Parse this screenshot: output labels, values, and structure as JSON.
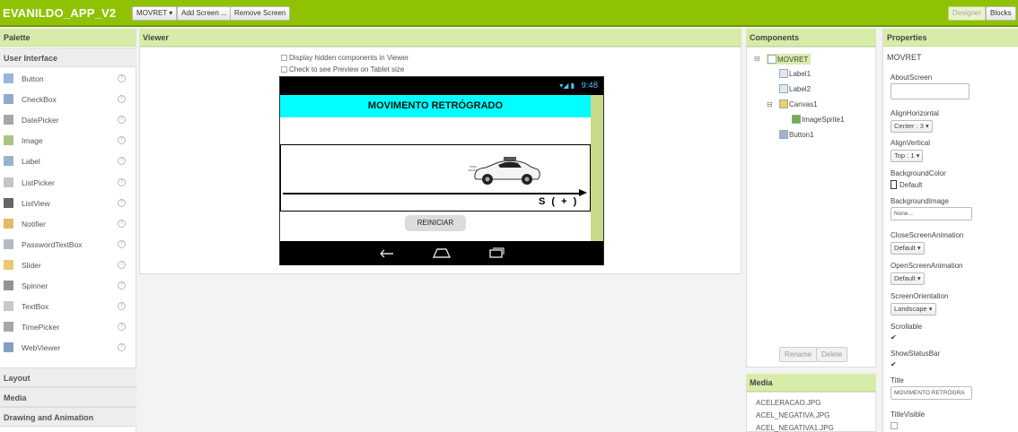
{
  "header": {
    "app_name": "EVANILDO_APP_V2",
    "screen_select": "MOVRET ▾",
    "add_screen": "Add Screen ...",
    "remove_screen": "Remove Screen",
    "designer": "Designer",
    "blocks": "Blocks"
  },
  "palette": {
    "title": "Palette",
    "category_open": "User Interface",
    "items": [
      {
        "label": "Button",
        "icon": "button-icon"
      },
      {
        "label": "CheckBox",
        "icon": "checkbox-icon"
      },
      {
        "label": "DatePicker",
        "icon": "datepicker-icon"
      },
      {
        "label": "Image",
        "icon": "image-icon"
      },
      {
        "label": "Label",
        "icon": "label-icon"
      },
      {
        "label": "ListPicker",
        "icon": "listpicker-icon"
      },
      {
        "label": "ListView",
        "icon": "listview-icon"
      },
      {
        "label": "Notifier",
        "icon": "notifier-icon"
      },
      {
        "label": "PasswordTextBox",
        "icon": "password-icon"
      },
      {
        "label": "Slider",
        "icon": "slider-icon"
      },
      {
        "label": "Spinner",
        "icon": "spinner-icon"
      },
      {
        "label": "TextBox",
        "icon": "textbox-icon"
      },
      {
        "label": "TimePicker",
        "icon": "timepicker-icon"
      },
      {
        "label": "WebViewer",
        "icon": "webviewer-icon"
      }
    ],
    "help_glyph": "?",
    "categories_collapsed": [
      "Layout",
      "Media",
      "Drawing and Animation"
    ]
  },
  "viewer": {
    "title": "Viewer",
    "hidden_components": "Display hidden components in Viewer",
    "tablet_preview": "Check to see Preview on Tablet size",
    "phone": {
      "status_time": "9:48",
      "status_icons": "▾◢ ▮",
      "title_label": "MOVIMENTO RETRÓGRADO",
      "axis_label": "S ( + )",
      "button_label": "REINICIAR",
      "nav_back": "⮌",
      "nav_home": "⌂",
      "nav_recent": "▭"
    }
  },
  "components": {
    "title": "Components",
    "tree": [
      {
        "label": "MOVRET",
        "level": 0,
        "expander": "⊟",
        "icon": "screen-icon"
      },
      {
        "label": "Label1",
        "level": 1,
        "expander": "",
        "icon": "label-icon"
      },
      {
        "label": "Label2",
        "level": 1,
        "expander": "",
        "icon": "label-icon"
      },
      {
        "label": "Canvas1",
        "level": 1,
        "expander": "⊟",
        "icon": "canvas-icon"
      },
      {
        "label": "ImageSprite1",
        "level": 2,
        "expander": "",
        "icon": "imagesprite-icon"
      },
      {
        "label": "Button1",
        "level": 1,
        "expander": "",
        "icon": "button-icon"
      }
    ],
    "rename": "Rename",
    "delete": "Delete"
  },
  "media": {
    "title": "Media",
    "items": [
      "ACELERACAO.JPG",
      "ACEL_NEGATIVA.JPG",
      "ACEL_NEGATIVA1.JPG"
    ]
  },
  "properties": {
    "title": "Properties",
    "component": "MOVRET",
    "about_screen_label": "AboutScreen",
    "about_screen_value": "",
    "align_horizontal_label": "AlignHorizontal",
    "align_horizontal_value": "Center : 3 ▾",
    "align_vertical_label": "AlignVertical",
    "align_vertical_value": "Top : 1 ▾",
    "background_color_label": "BackgroundColor",
    "background_color_value": "Default",
    "background_image_label": "BackgroundImage",
    "background_image_value": "None...",
    "close_anim_label": "CloseScreenAnimation",
    "close_anim_value": "Default ▾",
    "open_anim_label": "OpenScreenAnimation",
    "open_anim_value": "Default ▾",
    "orientation_label": "ScreenOrientation",
    "orientation_value": "Landscape ▾",
    "scrollable_label": "Scrollable",
    "scrollable_checked": true,
    "show_statusbar_label": "ShowStatusBar",
    "show_statusbar_checked": true,
    "title_label": "Title",
    "title_value": "MOVIMENTO RETRÓGRA",
    "title_visible_label": "TitleVisible",
    "title_visible_checked": false,
    "check_glyph": "✔"
  },
  "colors": {
    "brand_green": "#8fc202",
    "panel_header": "#d8ecaa",
    "title_cyan": "#00ffff"
  }
}
